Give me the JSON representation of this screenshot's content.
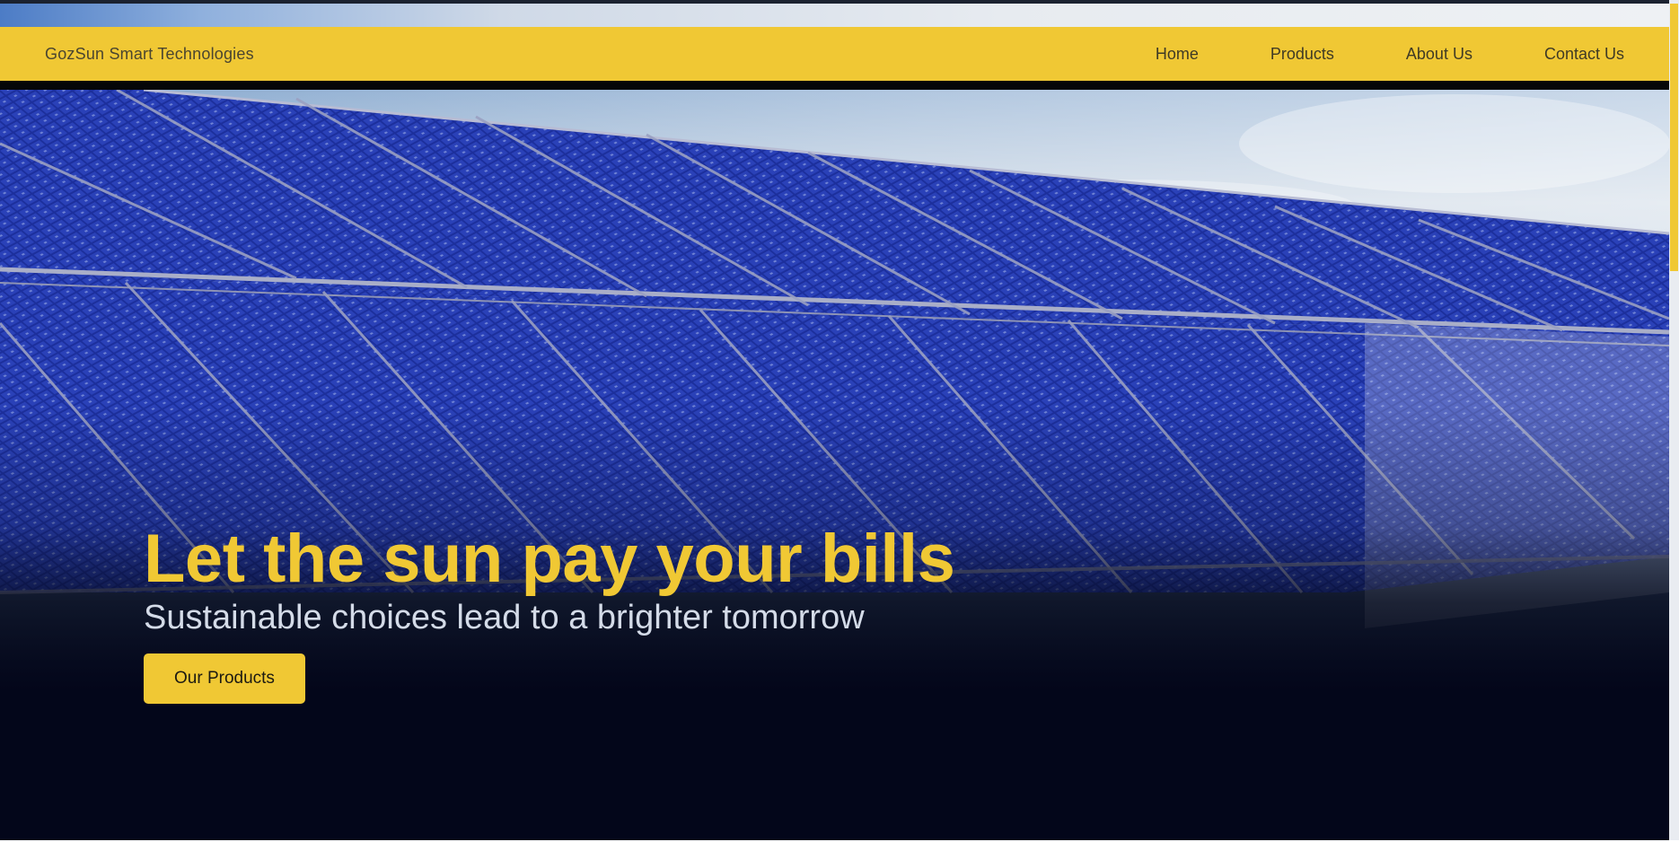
{
  "window": {
    "title": "GozSun Smart Technologies"
  },
  "navbar": {
    "brand": "GozSun Smart Technologies",
    "links": [
      {
        "label": "Home"
      },
      {
        "label": "Products"
      },
      {
        "label": "About Us"
      },
      {
        "label": "Contact Us"
      }
    ],
    "background_color": "#f0c834"
  },
  "hero": {
    "title": "Let the sun pay your bills",
    "subtitle": "Sustainable choices lead to a brighter tomorrow",
    "cta_label": "Our Products",
    "background_image": "solar-panel-array-photo",
    "accent_color": "#f0c834",
    "subtitle_color": "#d4dbe8",
    "dark_color": "#03061a"
  }
}
